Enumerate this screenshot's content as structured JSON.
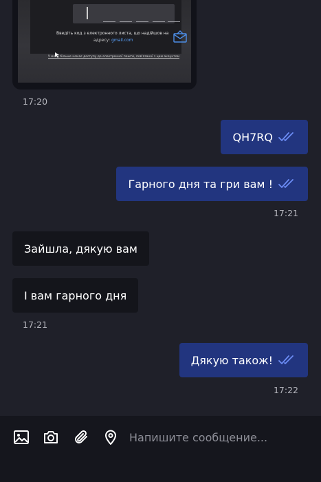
{
  "photo": {
    "instruction": "Введіть код з електронного листа, що надійшов на",
    "address_label": "адресу:",
    "address_value": "gmail.com",
    "footnote": "У мене більше немає доступу до електронної пошти, пов'язаної з цим акаунтом"
  },
  "messages": [
    {
      "id": "photo-time",
      "time": "17:20"
    },
    {
      "id": "m1",
      "text": "QH7RQ"
    },
    {
      "id": "m2",
      "text": "Гарного дня та гри вам !",
      "time": "17:21"
    },
    {
      "id": "m3",
      "text": "Зайшла, дякую вам"
    },
    {
      "id": "m4",
      "text": "І вам гарного дня",
      "time": "17:21"
    },
    {
      "id": "m5",
      "text": "Дякую також!",
      "time": "17:22"
    }
  ],
  "composer": {
    "placeholder": "Напишите сообщение...",
    "tools": [
      "image-icon",
      "camera-icon",
      "paperclip-icon",
      "location-pin-icon"
    ]
  },
  "colors": {
    "background": "#1f2029",
    "outgoing_bubble": "#22357f",
    "incoming_bubble": "#14151b",
    "read_check": "#6c8cf5",
    "input_bar": "#15161d"
  }
}
